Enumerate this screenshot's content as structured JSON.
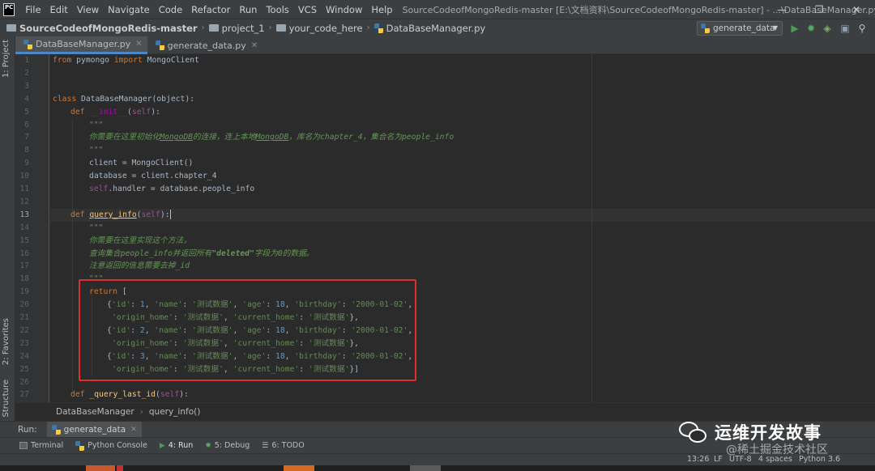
{
  "app": {
    "logo_text": "PC",
    "menu": [
      "File",
      "Edit",
      "View",
      "Navigate",
      "Code",
      "Refactor",
      "Run",
      "Tools",
      "VCS",
      "Window",
      "Help"
    ],
    "window_title": "SourceCodeofMongoRedis-master [E:\\文档资料\\SourceCodeofMongoRedis-master] - ...\\DataBaseManager.py"
  },
  "window_controls": {
    "minimize": "—",
    "maximize": "❐",
    "close": "✕"
  },
  "navbar": {
    "crumbs": [
      "SourceCodeofMongoRedis-master",
      "project_1",
      "your_code_here",
      "DataBaseManager.py"
    ],
    "run_config": "generate_data"
  },
  "tool_tabs_left": [
    "1: Project",
    "2: Favorites",
    "Z: Structure"
  ],
  "editor_tabs": [
    {
      "label": "DataBaseManager.py",
      "active": true
    },
    {
      "label": "generate_data.py",
      "active": false
    }
  ],
  "editor": {
    "current_line": 13,
    "line_numbers": [
      "1",
      "2",
      "3",
      "4",
      "5",
      "6",
      "7",
      "8",
      "9",
      "10",
      "11",
      "12",
      "13",
      "14",
      "15",
      "16",
      "17",
      "18",
      "19",
      "20",
      "21",
      "22",
      "23",
      "24",
      "25",
      "26",
      "27"
    ],
    "lines": {
      "l1": [
        "from",
        " pymongo ",
        "import",
        " MongoClient"
      ],
      "l4": [
        "class",
        " DataBaseManager(object):"
      ],
      "l5": [
        "def",
        " ",
        "__init__",
        "(",
        "self",
        "):"
      ],
      "l6": "\"\"\"",
      "l7": [
        "你需要在这里初始化",
        "MongoDB",
        "的连接，连上本地",
        "MongoDB",
        "，库名为chapter_4，集合名为people_info"
      ],
      "l8": "\"\"\"",
      "l9": "client = MongoClient()",
      "l10": "database = client.chapter_4",
      "l11": [
        "self",
        ".handler = database.people_info"
      ],
      "l13": [
        "def",
        " ",
        "query_info",
        "(",
        "self",
        "):"
      ],
      "l14": "\"\"\"",
      "l15": "你需要在这里实现这个方法，",
      "l16": [
        "查询集合",
        "people_info",
        "并返回所有",
        "\"deleted\"",
        "字段为0的数据。"
      ],
      "l17": [
        "注意返回的信息需要去掉",
        "_id"
      ],
      "l18": "\"\"\"",
      "l19": [
        "return",
        " ["
      ],
      "l20": [
        "{",
        "'id'",
        ": ",
        "1",
        ", ",
        "'name'",
        ": ",
        "'测试数据'",
        ", ",
        "'age'",
        ": ",
        "18",
        ", ",
        "'birthday'",
        ": ",
        "'2000-01-02'",
        ","
      ],
      "l21": [
        "'origin_home'",
        ": ",
        "'测试数据'",
        ", ",
        "'current_home'",
        ": ",
        "'测试数据'",
        "},"
      ],
      "l22": [
        "{",
        "'id'",
        ": ",
        "2",
        ", ",
        "'name'",
        ": ",
        "'测试数据'",
        ", ",
        "'age'",
        ": ",
        "18",
        ", ",
        "'birthday'",
        ": ",
        "'2000-01-02'",
        ","
      ],
      "l23": [
        "'origin_home'",
        ": ",
        "'测试数据'",
        ", ",
        "'current_home'",
        ": ",
        "'测试数据'",
        "},"
      ],
      "l24": [
        "{",
        "'id'",
        ": ",
        "3",
        ", ",
        "'name'",
        ": ",
        "'测试数据'",
        ", ",
        "'age'",
        ": ",
        "18",
        ", ",
        "'birthday'",
        ": ",
        "'2000-01-02'",
        ","
      ],
      "l25": [
        "'origin_home'",
        ": ",
        "'测试数据'",
        ", ",
        "'current_home'",
        ": ",
        "'测试数据'",
        "}]"
      ],
      "l27": [
        "def",
        " ",
        "_query_last_id",
        "(",
        "self",
        "):"
      ]
    }
  },
  "structure_breadcrumb": [
    "DataBaseManager",
    "query_info()"
  ],
  "run_panel": {
    "label": "Run:",
    "tab": "generate_data"
  },
  "bottom_tools": [
    {
      "label": "Terminal",
      "active": false
    },
    {
      "label": "Python Console",
      "active": false
    },
    {
      "label": "4: Run",
      "active": true
    },
    {
      "label": "5: Debug",
      "active": false
    },
    {
      "label": "6: TODO",
      "active": false
    }
  ],
  "status": {
    "position": "13:26",
    "line_sep": "LF",
    "encoding": "UTF-8",
    "indent": "4 spaces",
    "interpreter": "Python 3.6"
  },
  "watermark": {
    "title": "运维开发故事",
    "sub": "@稀土掘金技术社区"
  },
  "colors": {
    "highlight_box": "#e02f2f",
    "accent_tab": "#4a88c7",
    "run_green": "#499c54",
    "debug_green": "#59a869"
  }
}
